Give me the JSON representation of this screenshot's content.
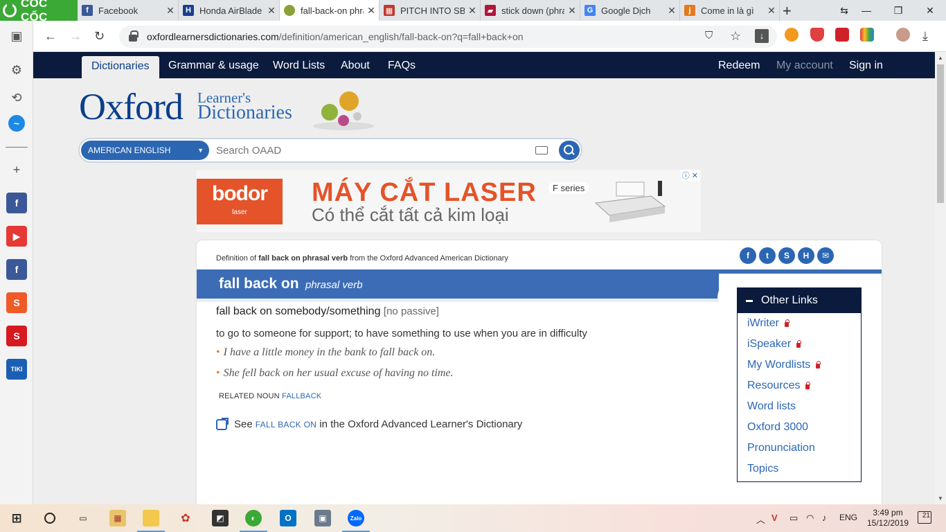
{
  "browser": {
    "brand": "CỐC CỐC",
    "tabs": [
      {
        "title": "Facebook",
        "icon": "facebook-icon",
        "color": "#3b5998",
        "glyph": "f"
      },
      {
        "title": "Honda AirBlade",
        "icon": "honda-icon",
        "color": "#1b3f8f",
        "glyph": "H"
      },
      {
        "title": "fall-back-on phra",
        "icon": "oxford-icon",
        "color": "#8aa13a",
        "glyph": "●"
      },
      {
        "title": "PITCH INTO SB/S",
        "icon": "cambridge-icon",
        "color": "#c0392b",
        "glyph": "▦"
      },
      {
        "title": "stick down (phra",
        "icon": "book-icon",
        "color": "#b0173c",
        "glyph": "▰"
      },
      {
        "title": "Google Dịch",
        "icon": "google-translate-icon",
        "color": "#4285f4",
        "glyph": "G"
      },
      {
        "title": "Come in là gì",
        "icon": "j-icon",
        "color": "#e07b20",
        "glyph": "j"
      }
    ],
    "url_domain": "oxfordlearnersdictionaries.com",
    "url_path": "/definition/american_english/fall-back-on?q=fall+back+on"
  },
  "site": {
    "nav": [
      "Dictionaries",
      "Grammar & usage",
      "Word Lists",
      "About",
      "FAQs"
    ],
    "nav_right": [
      "Redeem",
      "My account",
      "Sign in"
    ],
    "logo_big": "Oxford",
    "logo_small1": "Learner's",
    "logo_small2": "Dictionaries",
    "search_dict": "AMERICAN ENGLISH",
    "search_placeholder": "Search OAAD"
  },
  "ad": {
    "brand": "bodor",
    "brand_sub": "laser",
    "headline": "MÁY CẮT LASER",
    "subline": "Có thể cắt tất cả kim loại",
    "series": "F series"
  },
  "entry": {
    "definition_of_prefix": "Definition of",
    "definition_of_bold": "fall back on phrasal verb",
    "definition_of_suffix": "from the Oxford Advanced American Dictionary",
    "headword": "fall back on",
    "pos": "phrasal verb",
    "sense": "fall back on somebody/something",
    "grammar": "[no passive]",
    "definition": "to go to someone for support; to have something to use when you are in difficulty",
    "examples": [
      "I have a little money in the bank to fall back on.",
      "She fell back on her usual excuse of having no time."
    ],
    "related_label": "RELATED NOUN",
    "related_word": "FALLBACK",
    "see_prefix": "See",
    "see_link": "FALL BACK ON",
    "see_suffix": "in the Oxford Advanced Learner's Dictionary"
  },
  "other_links": {
    "title": "Other Links",
    "items": [
      {
        "label": "iWriter",
        "locked": true
      },
      {
        "label": "iSpeaker",
        "locked": true
      },
      {
        "label": "My Wordlists",
        "locked": true
      },
      {
        "label": "Resources",
        "locked": true
      },
      {
        "label": "Word lists",
        "locked": false
      },
      {
        "label": "Oxford 3000",
        "locked": false
      },
      {
        "label": "Pronunciation",
        "locked": false
      },
      {
        "label": "Topics",
        "locked": false
      }
    ]
  },
  "taskbar": {
    "language": "ENG",
    "time": "3:49 pm",
    "date": "15/12/2019",
    "notifications": "21"
  },
  "colors": {
    "oxford_navy": "#0a1b3d",
    "oxford_blue": "#2b66b3",
    "headword_bar": "#3b6cb5",
    "ad_orange": "#e4532a",
    "coccoc_green": "#3aa935"
  }
}
